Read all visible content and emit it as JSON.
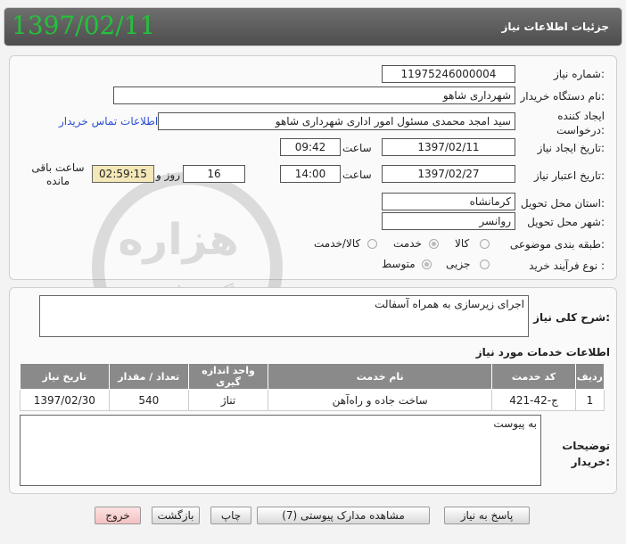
{
  "header": {
    "title": "جزئیات اطلاعات نیاز",
    "date": "1397/02/11"
  },
  "form": {
    "need_number": {
      "label": "شماره نیاز:",
      "value": "11975246000004"
    },
    "buyer_org": {
      "label": "نام دستگاه خریدار:",
      "value": "شهرداری شاهو"
    },
    "creator": {
      "label": "ایجاد کننده درخواست:",
      "value": "سید امجد محمدی مسئول امور اداری شهرداری شاهو",
      "contact_link": "اطلاعات تماس خریدار"
    },
    "created": {
      "label": "تاریخ ایجاد نیاز:",
      "date": "1397/02/11",
      "time_label": "ساعت",
      "time": "09:42"
    },
    "validity": {
      "label": "تاریخ اعتبار نیاز:",
      "date": "1397/02/27",
      "time_label": "ساعت",
      "time": "14:00",
      "days": "16",
      "days_label": "روز و",
      "remaining": "02:59:15",
      "remaining_label": "ساعت باقی مانده"
    },
    "province": {
      "label": "استان محل تحویل:",
      "value": "کرمانشاه"
    },
    "city": {
      "label": "شهر محل تحویل:",
      "value": "روانسر"
    },
    "category": {
      "label": "طبقه بندی موضوعی:",
      "options": [
        "کالا",
        "خدمت",
        "کالا/خدمت"
      ],
      "selected": "خدمت"
    },
    "process": {
      "label": "نوع فرآیند خرید :",
      "options": [
        "جزیی",
        "متوسط"
      ],
      "selected": "متوسط"
    }
  },
  "description": {
    "label": "شرح کلی نیاز:",
    "value": "اجرای زیرسازی به همراه آسفالت"
  },
  "services": {
    "title": "اطلاعات خدمات مورد نیاز",
    "columns": [
      "ردیف",
      "کد خدمت",
      "نام خدمت",
      "واحد اندازه گیری",
      "تعداد / مقدار",
      "تاریخ نیاز"
    ],
    "rows": [
      [
        "1",
        "ج-42-421",
        "ساخت جاده و راه‌آهن",
        "تناژ",
        "540",
        "1397/02/30"
      ]
    ]
  },
  "buyer_notes": {
    "label": "توضیحات خریدار:",
    "value": "به پیوست"
  },
  "buttons": {
    "reply": "پاسخ به نیاز",
    "attachments": "مشاهده مدارک پیوستی (7)",
    "print": "چاپ",
    "back": "بازگشت",
    "exit": "خروج"
  },
  "colors": {
    "header_date": "#23c23a",
    "exit_button": "#f4c0c0",
    "timer_bg": "#f4e7b8"
  }
}
